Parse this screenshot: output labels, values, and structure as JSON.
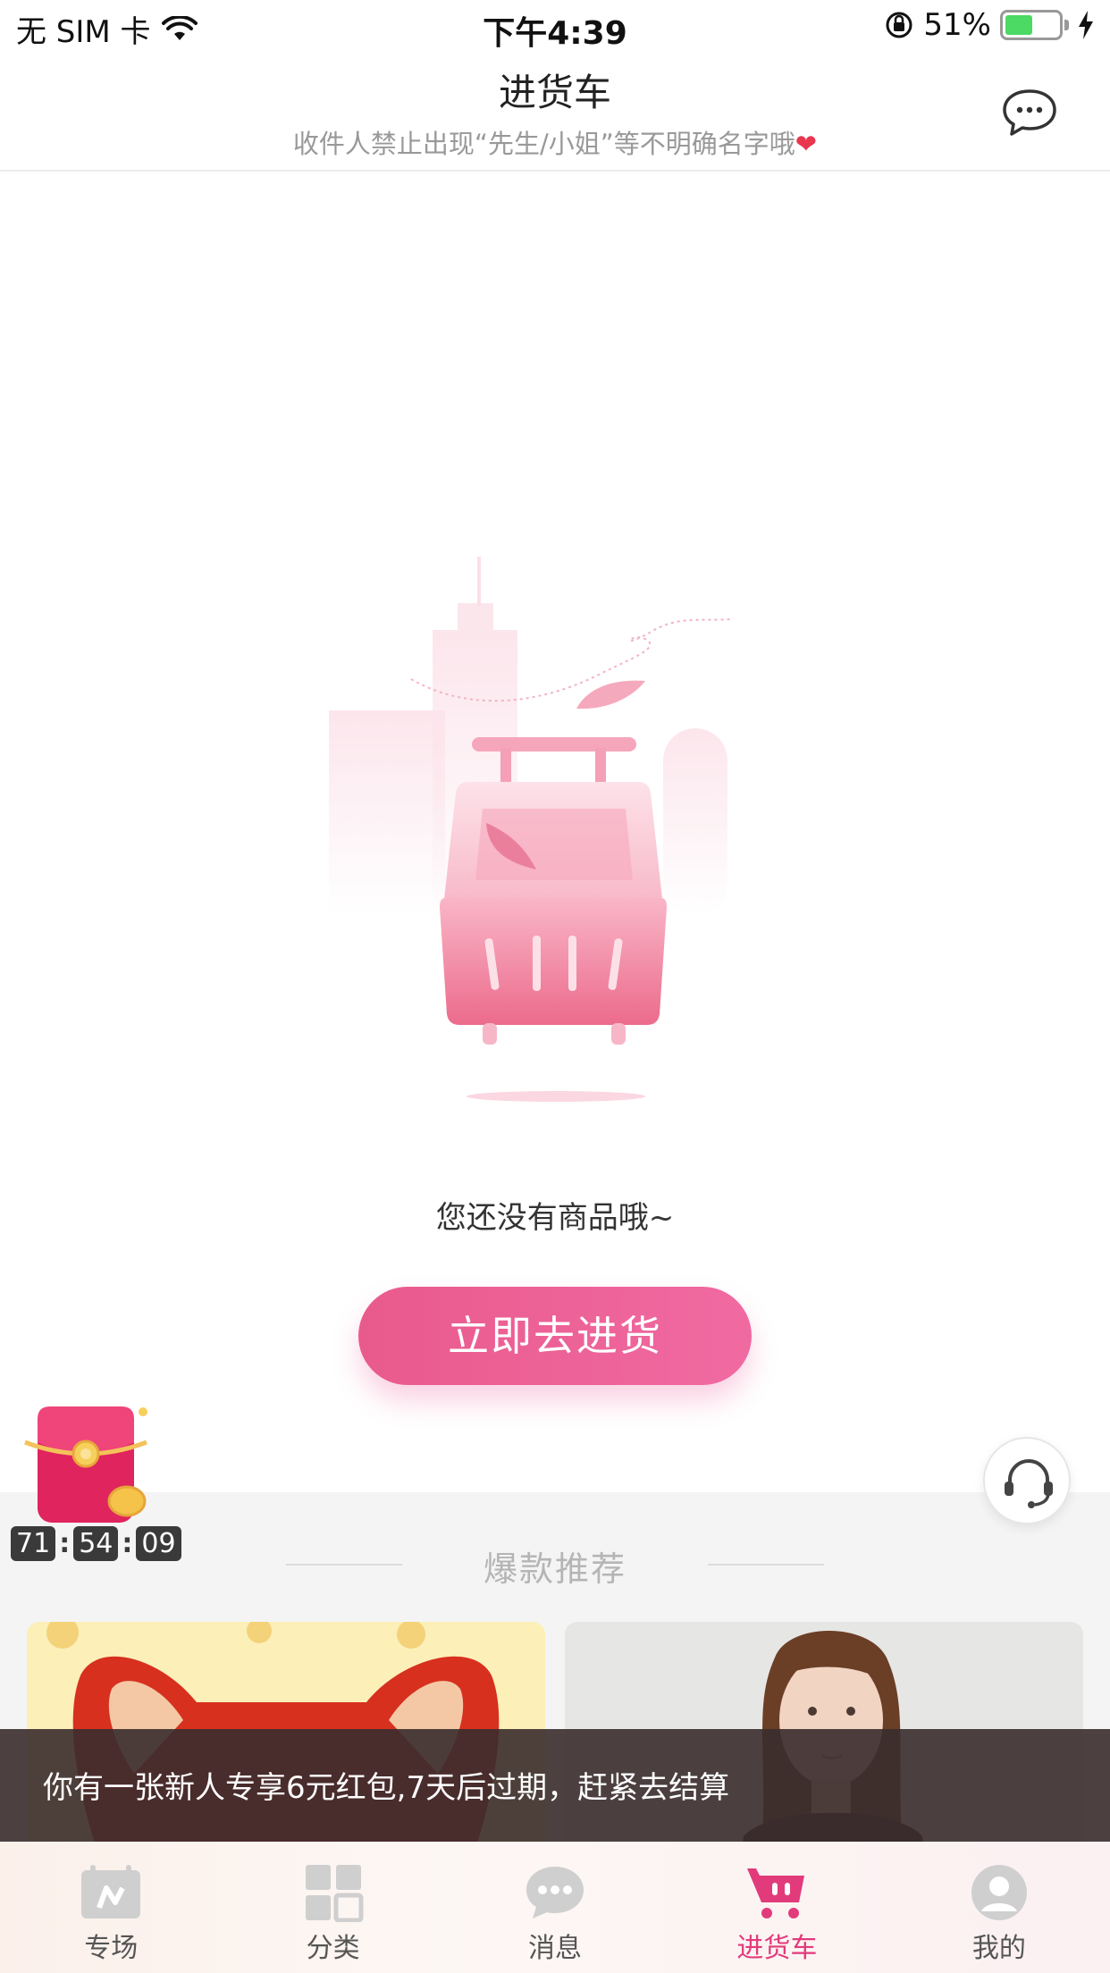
{
  "status_bar": {
    "carrier": "无 SIM 卡",
    "time": "下午4:39",
    "battery": "51%",
    "battery_level": 0.51
  },
  "nav": {
    "title": "进货车",
    "subtitle": "收件人禁止出现“先生/小姐”等不明确名字哦",
    "subtitle_emoji": "❤",
    "chat_icon": "chat-bubble-icon"
  },
  "empty_state": {
    "message": "您还没有商品哦~",
    "button_label": "立即去进货"
  },
  "floating": {
    "countdown": {
      "hours": "71",
      "minutes": "54",
      "seconds": "09"
    }
  },
  "recommend": {
    "title": "爆款推荐"
  },
  "toast": {
    "text": "你有一张新人专享6元红包,7天后过期，赶紧去结算"
  },
  "tabbar": {
    "items": [
      {
        "label": "专场",
        "icon": "calendar-icon",
        "active": false
      },
      {
        "label": "分类",
        "icon": "grid-icon",
        "active": false
      },
      {
        "label": "消息",
        "icon": "message-icon",
        "active": false
      },
      {
        "label": "进货车",
        "icon": "cart-icon",
        "active": true
      },
      {
        "label": "我的",
        "icon": "user-icon",
        "active": false
      }
    ]
  },
  "colors": {
    "accent": "#e23b7b",
    "button_gradient_start": "#e95a8c",
    "button_gradient_end": "#f06aa2"
  }
}
